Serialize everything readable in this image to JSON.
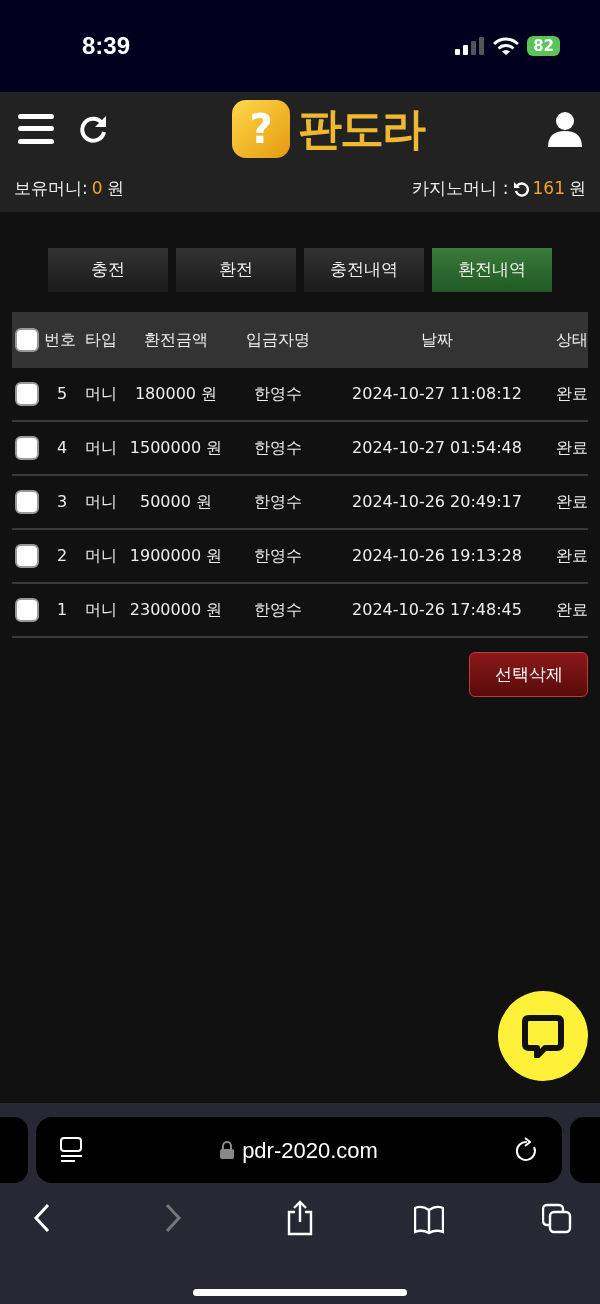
{
  "status_bar": {
    "time": "8:39",
    "battery": "82"
  },
  "header": {
    "logo_mark": "?",
    "logo_text": "판도라"
  },
  "balance": {
    "label": "보유머니:",
    "amount": "0",
    "unit": "원",
    "casino_label": "카지노머니 :",
    "casino_amount": "161",
    "casino_unit": "원"
  },
  "tabs": [
    {
      "label": "충전",
      "selected": false
    },
    {
      "label": "환전",
      "selected": false
    },
    {
      "label": "충전내역",
      "selected": false
    },
    {
      "label": "환전내역",
      "selected": true
    }
  ],
  "table": {
    "select_all": {
      "checked": false
    },
    "columns": [
      "번호",
      "타입",
      "환전금액",
      "입금자명",
      "날짜",
      "상태"
    ],
    "rows": [
      {
        "checked": false,
        "cells": [
          "5",
          "머니",
          "180000 원",
          "한영수",
          "2024-10-27 11:08:12",
          "완료"
        ]
      },
      {
        "checked": false,
        "cells": [
          "4",
          "머니",
          "1500000 원",
          "한영수",
          "2024-10-27 01:54:48",
          "완료"
        ]
      },
      {
        "checked": false,
        "cells": [
          "3",
          "머니",
          "50000 원",
          "한영수",
          "2024-10-26 20:49:17",
          "완료"
        ]
      },
      {
        "checked": false,
        "cells": [
          "2",
          "머니",
          "1900000 원",
          "한영수",
          "2024-10-26 19:13:28",
          "완료"
        ]
      },
      {
        "checked": false,
        "cells": [
          "1",
          "머니",
          "2300000 원",
          "한영수",
          "2024-10-26 17:48:45",
          "완료"
        ]
      }
    ]
  },
  "delete_button": "선택삭제",
  "browser": {
    "url": "pdr-2020.com",
    "back_disabled": false,
    "forward_disabled": true
  }
}
